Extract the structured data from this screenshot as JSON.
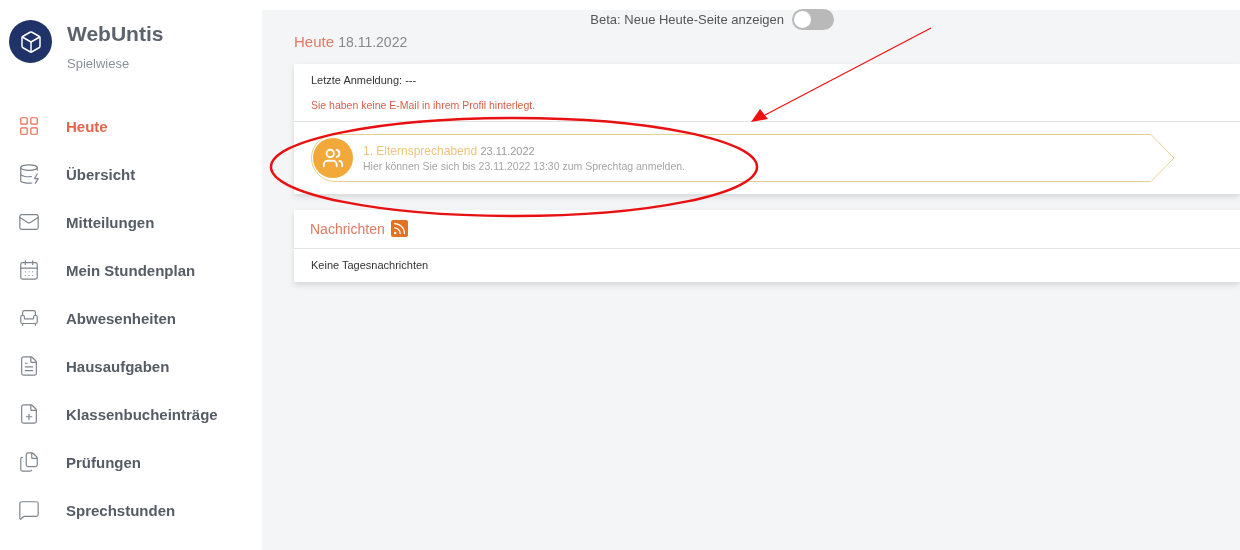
{
  "brand": {
    "title": "WebUntis",
    "subtitle": "Spielwiese"
  },
  "sidebar": {
    "items": [
      {
        "label": "Heute",
        "selected": true
      },
      {
        "label": "Übersicht",
        "selected": false
      },
      {
        "label": "Mitteilungen",
        "selected": false
      },
      {
        "label": "Mein Stundenplan",
        "selected": false
      },
      {
        "label": "Abwesenheiten",
        "selected": false
      },
      {
        "label": "Hausaufgaben",
        "selected": false
      },
      {
        "label": "Klassenbucheinträge",
        "selected": false
      },
      {
        "label": "Prüfungen",
        "selected": false
      },
      {
        "label": "Sprechstunden",
        "selected": false
      }
    ]
  },
  "beta_toggle": {
    "label": "Beta: Neue Heute-Seite anzeigen",
    "on": false
  },
  "heading": {
    "title": "Heute",
    "date": "18.11.2022"
  },
  "login_card": {
    "last_login": "Letzte Anmeldung: ---",
    "warning": "Sie haben keine E-Mail in ihrem Profil hinterlegt.",
    "event": {
      "title": "1. Elternsprechabend",
      "date": "23.11.2022",
      "text": "Hier können Sie sich bis 23.11.2022 13:30 zum Sprechtag anmelden."
    }
  },
  "news_card": {
    "title": "Nachrichten",
    "text": "Keine Tagesnachrichten"
  }
}
